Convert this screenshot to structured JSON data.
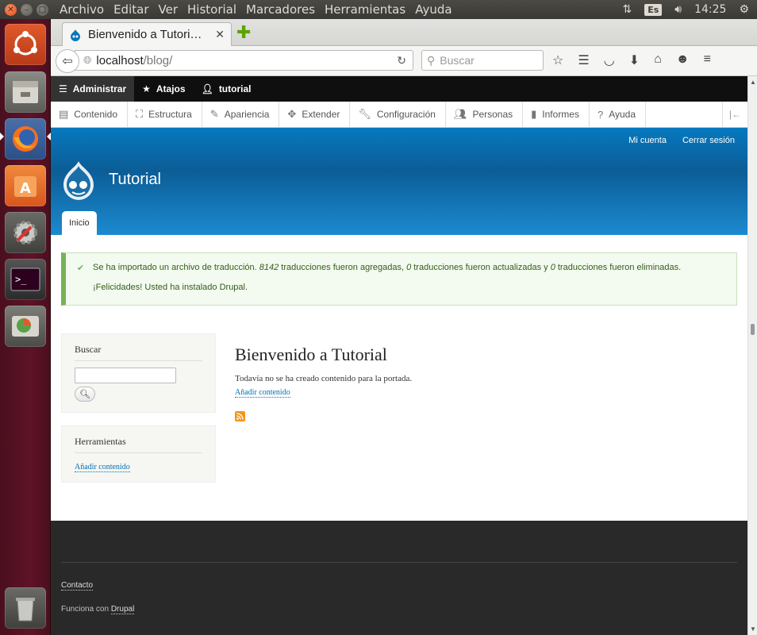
{
  "panel": {
    "menu": [
      "Archivo",
      "Editar",
      "Ver",
      "Historial",
      "Marcadores",
      "Herramientas",
      "Ayuda"
    ],
    "keyboard": "Es",
    "clock": "14:25"
  },
  "browser": {
    "tab_title": "Bienvenido a Tutori…",
    "url_host": "localhost",
    "url_path": "/blog/",
    "search_placeholder": "Buscar"
  },
  "admin_toolbar": {
    "admin": "Administrar",
    "shortcuts": "Atajos",
    "user": "tutorial"
  },
  "admin_tray": [
    "Contenido",
    "Estructura",
    "Apariencia",
    "Extender",
    "Configuración",
    "Personas",
    "Informes",
    "Ayuda"
  ],
  "header": {
    "my_account": "Mi cuenta",
    "logout": "Cerrar sesión",
    "site_name": "Tutorial",
    "tab_home": "Inicio"
  },
  "messages": {
    "part1": "Se ha importado un archivo de traducción. ",
    "added_count": "8142",
    "part2": " traducciones fueron agregadas, ",
    "updated_count": "0",
    "part3": " traducciones fueron actualizadas y ",
    "deleted_count": "0",
    "part4": " traducciones fueron eliminadas.",
    "line2": "¡Felicidades! Usted ha instalado Drupal."
  },
  "sidebar": {
    "search_title": "Buscar",
    "tools_title": "Herramientas",
    "tools_link": "Añadir contenido"
  },
  "main": {
    "title": "Bienvenido a Tutorial",
    "text": "Todavía no se ha creado contenido para la portada.",
    "link": "Añadir contenido"
  },
  "footer": {
    "contact": "Contacto",
    "powered_prefix": "Funciona con ",
    "powered_link": "Drupal"
  }
}
